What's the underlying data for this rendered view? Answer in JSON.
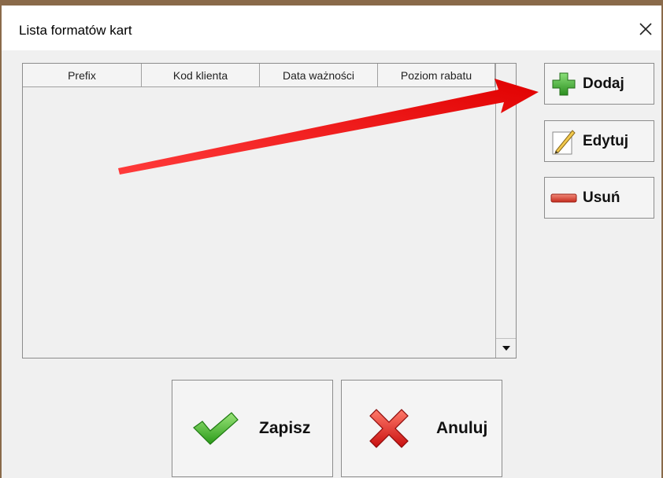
{
  "window": {
    "title": "Lista formatów kart"
  },
  "table": {
    "columns": [
      "Prefix",
      "Kod klienta",
      "Data ważności",
      "Poziom rabatu"
    ]
  },
  "side_buttons": {
    "add": "Dodaj",
    "edit": "Edytuj",
    "delete": "Usuń"
  },
  "bottom_buttons": {
    "save": "Zapisz",
    "cancel": "Anuluj"
  },
  "colors": {
    "annotation_arrow": "#ff1a1a",
    "add_icon": "#3aa02e",
    "delete_icon": "#d9382a",
    "check_icon": "#36b51e",
    "cancel_icon": "#e02020"
  }
}
